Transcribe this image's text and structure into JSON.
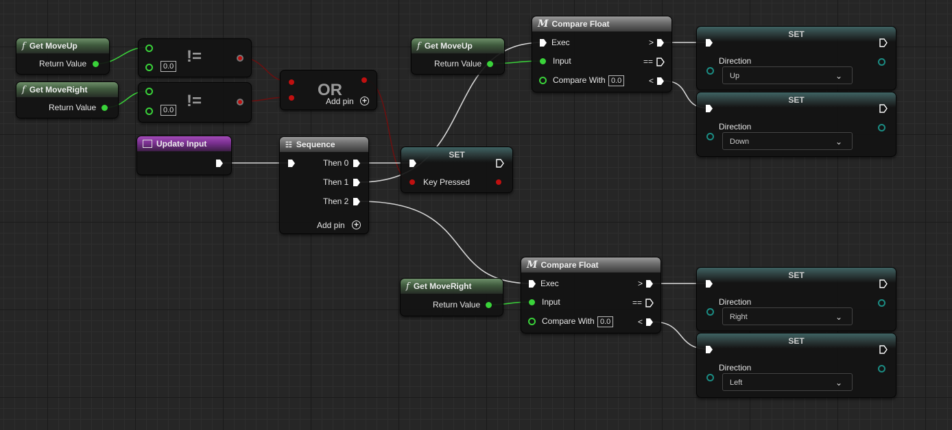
{
  "nodes": {
    "get_moveup_1": {
      "title": "Get MoveUp",
      "output": "Return Value"
    },
    "get_moveright_1": {
      "title": "Get MoveRight",
      "output": "Return Value"
    },
    "neq_1": {
      "op": "!=",
      "value": "0.0"
    },
    "neq_2": {
      "op": "!=",
      "value": "0.0"
    },
    "or": {
      "op": "OR",
      "add_pin": "Add pin"
    },
    "update_input": {
      "title": "Update Input"
    },
    "sequence": {
      "title": "Sequence",
      "then0": "Then 0",
      "then1": "Then 1",
      "then2": "Then 2",
      "add_pin": "Add pin"
    },
    "set_key": {
      "title": "SET",
      "var": "Key Pressed"
    },
    "get_moveup_2": {
      "title": "Get MoveUp",
      "output": "Return Value"
    },
    "compare_1": {
      "title": "Compare Float",
      "exec": "Exec",
      "input": "Input",
      "compare_with": "Compare With",
      "compare_value": "0.0",
      "gt": ">",
      "eq": "==",
      "lt": "<"
    },
    "get_moveright_2": {
      "title": "Get MoveRight",
      "output": "Return Value"
    },
    "compare_2": {
      "title": "Compare Float",
      "exec": "Exec",
      "input": "Input",
      "compare_with": "Compare With",
      "compare_value": "0.0",
      "gt": ">",
      "eq": "==",
      "lt": "<"
    },
    "set_up": {
      "title": "SET",
      "var": "Direction",
      "value": "Up"
    },
    "set_down": {
      "title": "SET",
      "var": "Direction",
      "value": "Down"
    },
    "set_right": {
      "title": "SET",
      "var": "Direction",
      "value": "Right"
    },
    "set_left": {
      "title": "SET",
      "var": "Direction",
      "value": "Left"
    }
  },
  "colors": {
    "float_pin": "#3ad33a",
    "bool_pin": "#c01010",
    "enum_pin": "#1b8d84",
    "exec_wire": "#d8d8d8",
    "function_header": "#4e6e4b",
    "event_header": "#8e38a6"
  },
  "icons": [
    "function-icon",
    "macro-icon",
    "event-icon",
    "sequence-icon",
    "exec-pin-icon",
    "add-pin-icon",
    "chevron-down-icon"
  ]
}
